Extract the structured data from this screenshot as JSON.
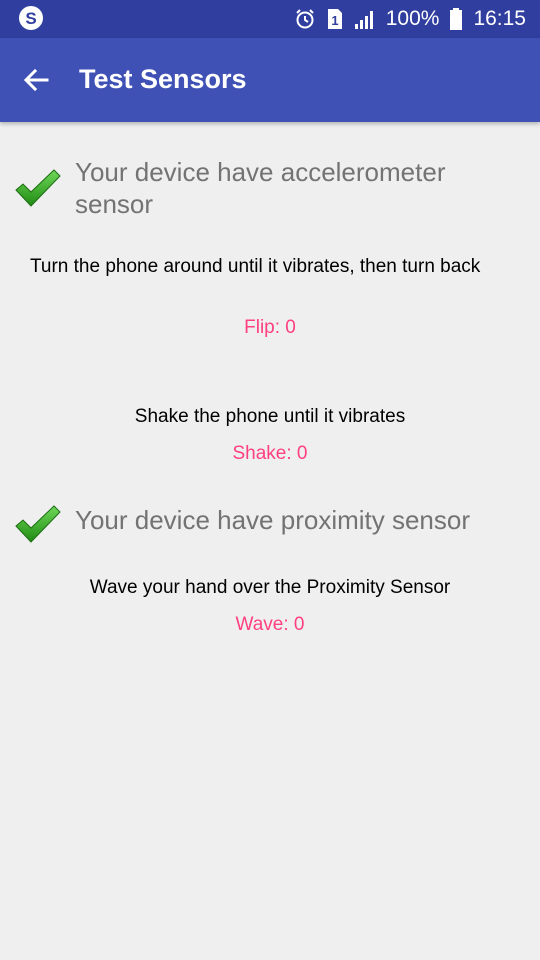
{
  "status_bar": {
    "battery_percent": "100%",
    "time": "16:15",
    "sim_slot": "1",
    "icons": [
      "skype-icon",
      "alarm-icon",
      "sim-icon",
      "signal-icon",
      "battery-icon"
    ]
  },
  "app_bar": {
    "title": "Test Sensors",
    "back_icon": "arrow-left-icon"
  },
  "accelerometer": {
    "title": "Your device have accelerometer sensor",
    "flip_instruction": "Turn the phone around until it vibrates, then turn back",
    "flip_counter": "Flip: 0",
    "shake_instruction": "Shake the phone until it vibrates",
    "shake_counter": "Shake: 0"
  },
  "proximity": {
    "title": "Your device have proximity sensor",
    "wave_instruction": "Wave your hand over the Proximity Sensor",
    "wave_counter": "Wave: 0"
  },
  "colors": {
    "status_bar": "#303f9f",
    "app_bar": "#3f51b5",
    "accent": "#ff4081",
    "check_green": "#2e9b1f",
    "background": "#efefef"
  }
}
